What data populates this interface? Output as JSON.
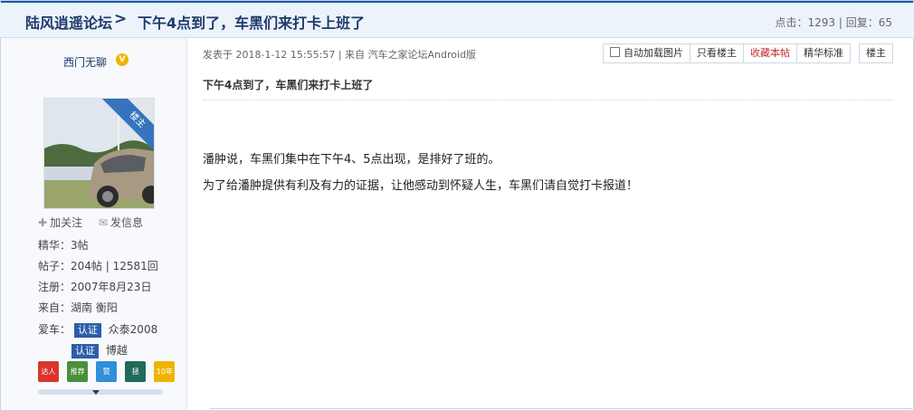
{
  "header": {
    "forum_name": "陆风逍遥论坛",
    "separator": ">",
    "thread_title": "下午4点到了，车黑们来打卡上班了",
    "stats": "点击：1293 | 回复：65"
  },
  "author": {
    "name": "西门无聊",
    "verified_icon": "v-icon",
    "ribbon": "楼主",
    "follow": "加关注",
    "message": "发信息",
    "stats": [
      "精华：3帖",
      "帖子：204帖 | 12581回",
      "注册：2007年8月23日",
      "来自：湖南 衡阳"
    ],
    "car_label": "爱车：",
    "cars": [
      {
        "tag": "认证",
        "name": "众泰2008"
      },
      {
        "tag": "认证",
        "name": "博越"
      }
    ],
    "medals": [
      "达人",
      "推荐",
      "赞",
      "拯",
      "10年"
    ]
  },
  "post": {
    "meta": "发表于 2018-1-12 15:55:57 | 来自 汽车之家论坛Android版",
    "toolbar": {
      "auto_load": "自动加载图片",
      "only_op": "只看楼主",
      "favorite": "收藏本帖",
      "standard": "精华标准",
      "owner": "楼主"
    },
    "title": "下午4点到了，车黑们来打卡上班了",
    "paragraphs": [
      "潘肿说，车黑们集中在下午4、5点出现，是排好了班的。",
      "为了给潘肿提供有利及有力的证据，让他感动到怀疑人生，车黑们请自觉打卡报道！"
    ]
  }
}
